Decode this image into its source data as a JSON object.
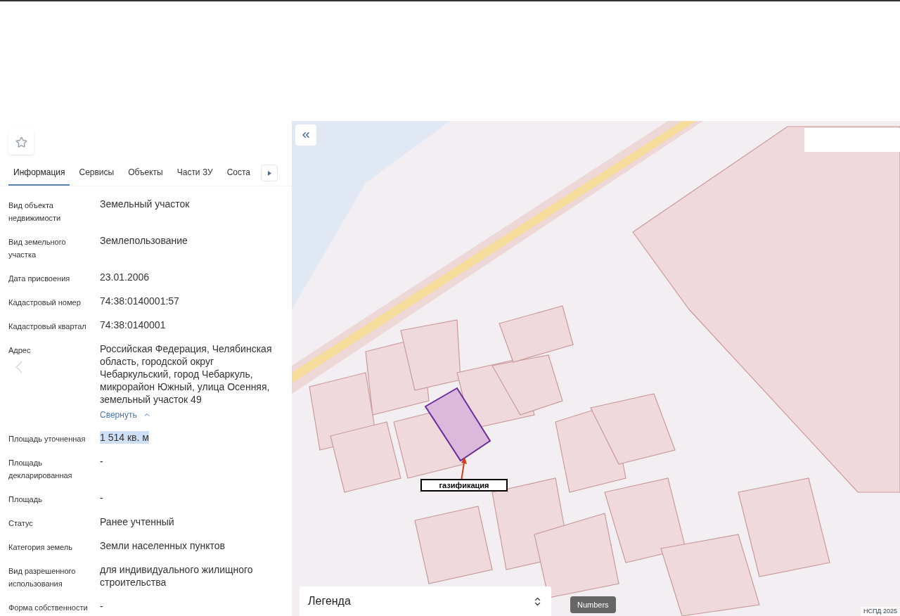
{
  "panel": {
    "tabs": [
      {
        "label": "Информация",
        "selected": true
      },
      {
        "label": "Сервисы",
        "selected": false
      },
      {
        "label": "Объекты",
        "selected": false
      },
      {
        "label": "Части ЗУ",
        "selected": false
      },
      {
        "label": "Соста",
        "selected": false
      }
    ],
    "fields": [
      {
        "label": "Вид объекта недвижимости",
        "value": "Земельный участок",
        "highlighted": false
      },
      {
        "label": "Вид земельного участка",
        "value": "Землепользование",
        "highlighted": false
      },
      {
        "label": "Дата присвоения",
        "value": "23.01.2006",
        "highlighted": false
      },
      {
        "label": "Кадастровый номер",
        "value": "74:38:0140001:57",
        "highlighted": false
      },
      {
        "label": "Кадастровый квартал",
        "value": "74:38:0140001",
        "highlighted": false
      },
      {
        "label": "Адрес",
        "value": "Российская Федерация, Челябинская область, городской округ Чебаркульский, город Чебаркуль, микрорайон Южный, улица Осенняя, земельный участок 49",
        "highlighted": false,
        "link": "Свернуть"
      },
      {
        "label": "Площадь уточненная",
        "value": "1 514 кв. м",
        "highlighted": true
      },
      {
        "label": "Площадь декларированная",
        "value": "-",
        "highlighted": false
      },
      {
        "label": "Площадь",
        "value": "-",
        "highlighted": false
      },
      {
        "label": "Статус",
        "value": "Ранее учтенный",
        "highlighted": false
      },
      {
        "label": "Категория земель",
        "value": "Земли населенных пунктов",
        "highlighted": false
      },
      {
        "label": "Вид разрешенного использования",
        "value": "для индивидуального жилищного строительства",
        "highlighted": false
      },
      {
        "label": "Форма собственности",
        "value": "-",
        "highlighted": false
      }
    ]
  },
  "map": {
    "annotation": "газификация",
    "legend": "Легенда",
    "tooltip": "Numbers",
    "attribution": "НСПД 2025"
  }
}
